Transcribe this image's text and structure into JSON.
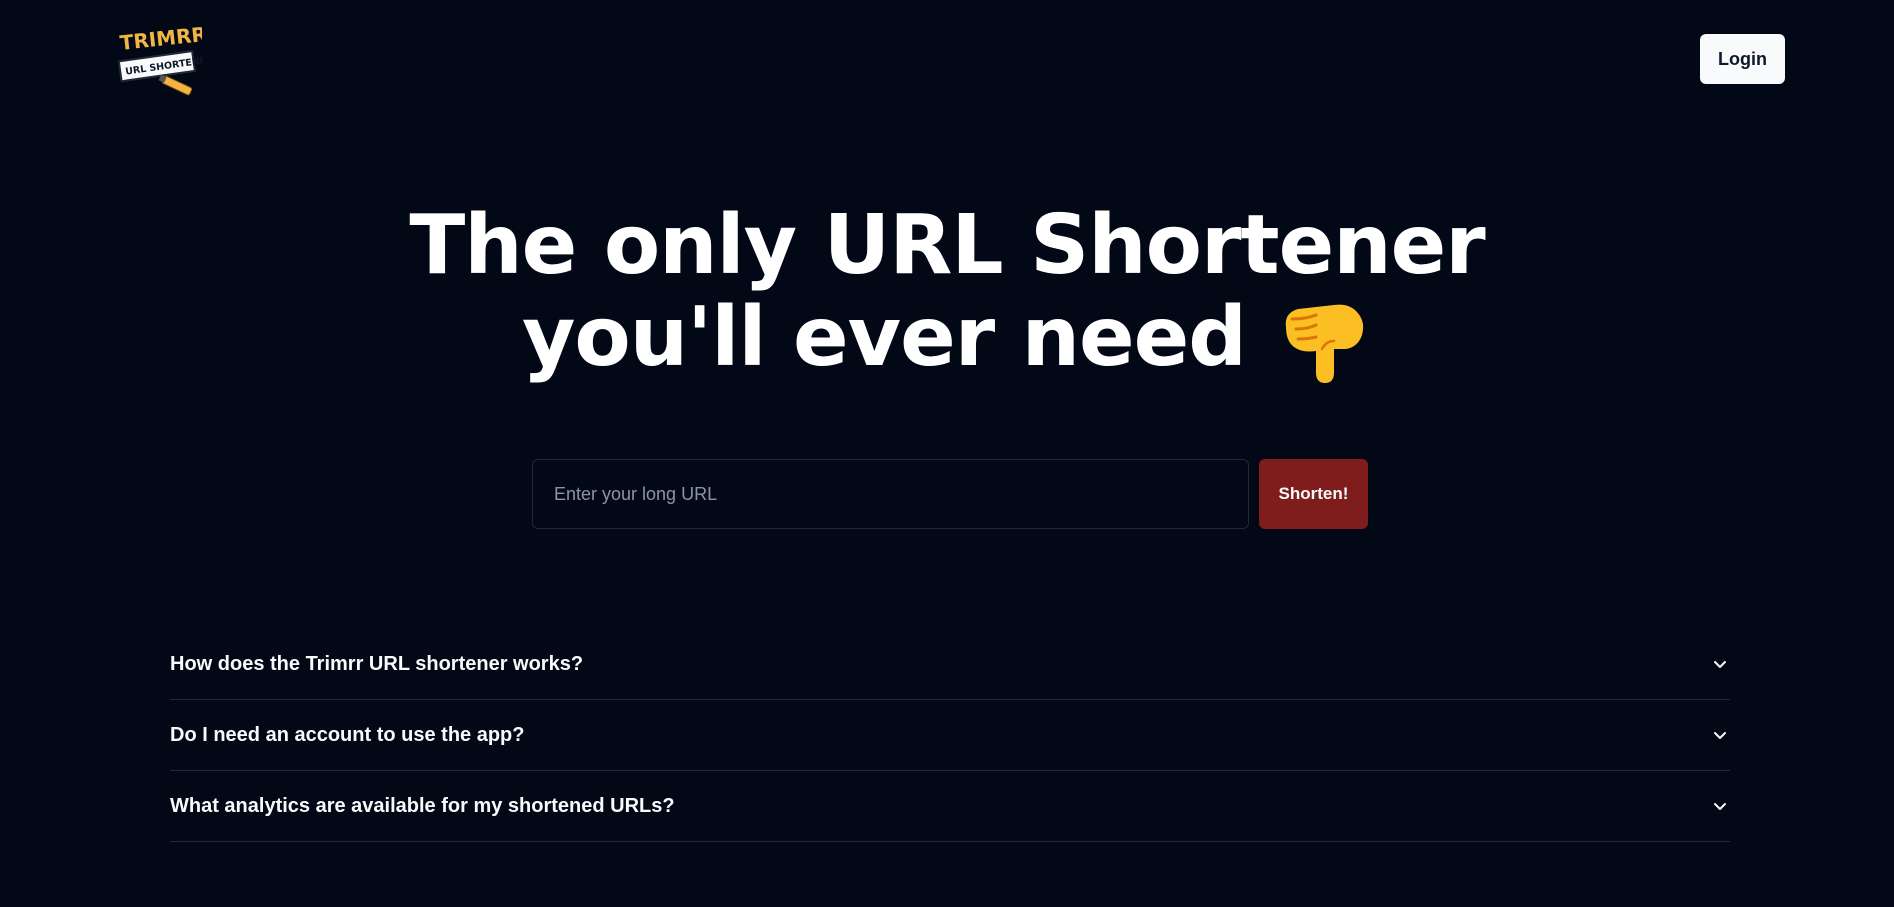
{
  "header": {
    "logo_top_text": "TRIMRR",
    "logo_bottom_text": "URL SHORTENER",
    "login_label": "Login"
  },
  "hero": {
    "line1": "The only URL Shortener",
    "line2": "you'll ever need",
    "icon": "backhand-index-pointing-down-icon"
  },
  "form": {
    "placeholder": "Enter your long URL",
    "value": "",
    "submit_label": "Shorten!"
  },
  "faq": {
    "items": [
      {
        "question": "How does the Trimrr URL shortener works?",
        "icon": "chevron-down-icon"
      },
      {
        "question": "Do I need an account to use the app?",
        "icon": "chevron-down-icon"
      },
      {
        "question": "What analytics are available for my shortened URLs?",
        "icon": "chevron-down-icon"
      }
    ]
  },
  "colors": {
    "background": "#030817",
    "text": "#f8fafc",
    "button_primary": "#7f1d1d",
    "border": "#1e293b",
    "logo_accent": "#f2b544"
  }
}
